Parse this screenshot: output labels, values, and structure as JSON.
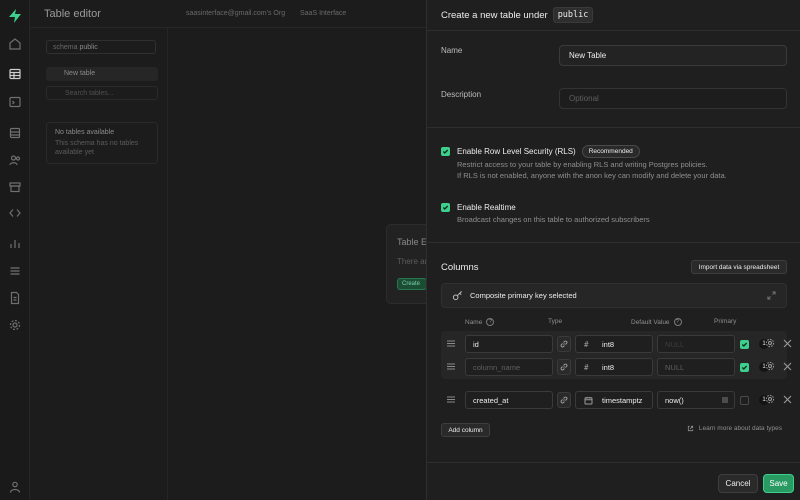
{
  "background": {
    "page_title": "Table editor",
    "org": "saasinterface@gmail.com's Org",
    "project": "SaaS Interface",
    "schema_label": "schema",
    "schema_value": "public",
    "new_table": "New table",
    "search_placeholder": "Search tables...",
    "no_tables_title": "No tables available",
    "no_tables_desc": "This schema has no tables available yet",
    "card_title": "Table E",
    "card_desc": "There ar",
    "card_button": "Create"
  },
  "panel": {
    "header_text": "Create a new table under",
    "header_schema": "public",
    "name_label": "Name",
    "name_value": "New Table",
    "description_label": "Description",
    "description_placeholder": "Optional",
    "rls": {
      "title": "Enable Row Level Security (RLS)",
      "badge": "Recommended",
      "desc1": "Restrict access to your table by enabling RLS and writing Postgres policies.",
      "desc2": "If RLS is not enabled, anyone with the anon key can modify and delete your data.",
      "checked": true
    },
    "realtime": {
      "title": "Enable Realtime",
      "desc": "Broadcast changes on this table to authorized subscribers",
      "checked": true
    },
    "columns_title": "Columns",
    "import_button": "Import data via spreadsheet",
    "pk_text": "Composite primary key selected",
    "headers": {
      "name": "Name",
      "type": "Type",
      "default": "Default Value",
      "primary": "Primary"
    },
    "rows": [
      {
        "name": "id",
        "name_placeholder": "",
        "type": "int8",
        "type_icon": "#",
        "default": "",
        "default_placeholder": "NULL",
        "primary": true,
        "badge": "1"
      },
      {
        "name": "",
        "name_placeholder": "column_name",
        "type": "int8",
        "type_icon": "#",
        "default": "",
        "default_placeholder": "NULL",
        "primary": true,
        "badge": "1"
      },
      {
        "name": "created_at",
        "name_placeholder": "",
        "type": "timestamptz",
        "type_icon": "calendar-icon",
        "default": "now()",
        "default_placeholder": "",
        "primary": false,
        "badge": "1"
      }
    ],
    "add_column": "Add column",
    "learn_more": "Learn more about data types",
    "cancel": "Cancel",
    "save": "Save"
  }
}
